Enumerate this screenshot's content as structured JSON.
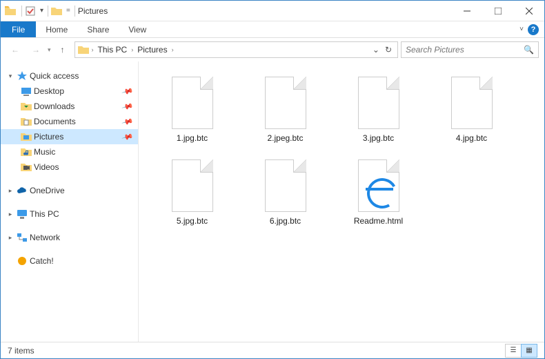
{
  "title": "Pictures",
  "ribbon": {
    "file_tab": "File",
    "tabs": [
      "Home",
      "Share",
      "View"
    ]
  },
  "breadcrumbs": [
    "This PC",
    "Pictures"
  ],
  "search_placeholder": "Search Pictures",
  "sidebar": {
    "quick_access": {
      "label": "Quick access",
      "items": [
        {
          "label": "Desktop",
          "pin": true
        },
        {
          "label": "Downloads",
          "pin": true
        },
        {
          "label": "Documents",
          "pin": true
        },
        {
          "label": "Pictures",
          "pin": true,
          "selected": true
        },
        {
          "label": "Music",
          "pin": false
        },
        {
          "label": "Videos",
          "pin": false
        }
      ]
    },
    "onedrive": {
      "label": "OneDrive"
    },
    "thispc": {
      "label": "This PC"
    },
    "network": {
      "label": "Network"
    },
    "catch": {
      "label": "Catch!"
    }
  },
  "files": [
    {
      "name": "1.jpg.btc",
      "type": "blank"
    },
    {
      "name": "2.jpeg.btc",
      "type": "blank"
    },
    {
      "name": "3.jpg.btc",
      "type": "blank"
    },
    {
      "name": "4.jpg.btc",
      "type": "blank"
    },
    {
      "name": "5.jpg.btc",
      "type": "blank"
    },
    {
      "name": "6.jpg.btc",
      "type": "blank"
    },
    {
      "name": "Readme.html",
      "type": "html"
    }
  ],
  "status": {
    "count_label": "7 items"
  }
}
